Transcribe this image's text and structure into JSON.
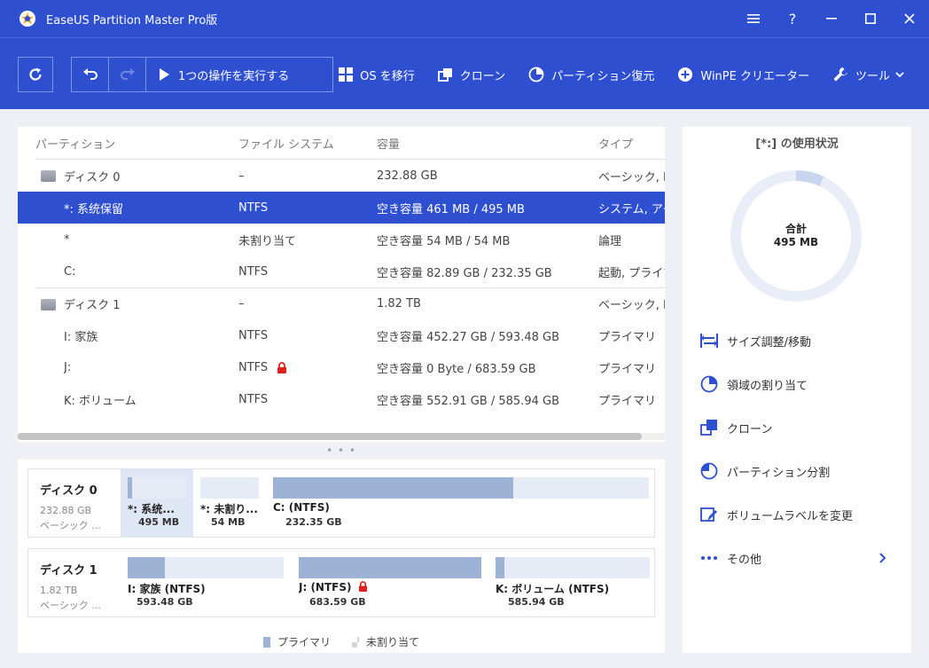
{
  "window": {
    "title": "EaseUS Partition Master Pro版"
  },
  "toolbar": {
    "run_label": "1つの操作を実行する",
    "actions": [
      "OS を移行",
      "クローン",
      "パーティション復元",
      "WinPE クリエーター",
      "ツール"
    ]
  },
  "table": {
    "headers": [
      "パーティション",
      "ファイル システム",
      "容量",
      "タイプ"
    ],
    "rows": [
      {
        "kind": "disk",
        "name": "ディスク 0",
        "fs": "–",
        "capacity": "232.88 GB",
        "type": "ベーシック, MBR"
      },
      {
        "kind": "part",
        "name": "*: 系统保留",
        "fs": "NTFS",
        "capacity": "空き容量 461 MB / 495 MB",
        "type": "システム, アクティブ",
        "selected": true
      },
      {
        "kind": "part",
        "name": "*",
        "fs": "未割り当て",
        "capacity": "空き容量 54 MB / 54 MB",
        "type": "論理"
      },
      {
        "kind": "part",
        "name": "C:",
        "fs": "NTFS",
        "capacity": "空き容量 82.89 GB / 232.35 GB",
        "type": "起動, プライマリ"
      },
      {
        "kind": "disk",
        "name": "ディスク 1",
        "fs": "–",
        "capacity": "1.82 TB",
        "type": "ベーシック, MBR"
      },
      {
        "kind": "part",
        "name": "I: 家族",
        "fs": "NTFS",
        "capacity": "空き容量 452.27 GB / 593.48 GB",
        "type": "プライマリ"
      },
      {
        "kind": "part",
        "name": "J:",
        "fs": "NTFS",
        "capacity": "空き容量 0 Byte / 683.59 GB",
        "type": "プライマリ",
        "locked": true
      },
      {
        "kind": "part",
        "name": "K: ボリューム",
        "fs": "NTFS",
        "capacity": "空き容量 552.91 GB / 585.94 GB",
        "type": "プライマリ"
      }
    ]
  },
  "map": {
    "disk0": {
      "name": "ディスク 0",
      "size": "232.88 GB",
      "type": "ベーシック ...",
      "segments": [
        {
          "label": "*: 系统...",
          "size": "495 MB",
          "used": 0.07
        },
        {
          "label": "*: 未割り...",
          "size": "54 MB"
        },
        {
          "label": "C: (NTFS)",
          "size": "232.35 GB",
          "used": 0.64
        }
      ]
    },
    "disk1": {
      "name": "ディスク 1",
      "size": "1.82 TB",
      "type": "ベーシック ...",
      "segments": [
        {
          "label": "I: 家族 (NTFS)",
          "size": "593.48 GB",
          "used": 0.24
        },
        {
          "label": "J: (NTFS)",
          "size": "683.59 GB",
          "used": 1.0,
          "locked": true
        },
        {
          "label": "K: ボリューム (NTFS)",
          "size": "585.94 GB",
          "used": 0.06
        }
      ]
    },
    "legend": [
      "プライマリ",
      "未割り当て"
    ]
  },
  "side": {
    "usage_title": "[*:] の使用状況",
    "total_label": "合計",
    "total_value": "495 MB",
    "used_fraction": 0.07,
    "ops": [
      "サイズ調整/移動",
      "領域の割り当て",
      "クローン",
      "パーティション分割",
      "ボリュームラベルを変更",
      "その他"
    ]
  },
  "colors": {
    "accent": "#2f4fd1",
    "primary_bar": "#9db3d6",
    "ring": "#e8edf7"
  }
}
